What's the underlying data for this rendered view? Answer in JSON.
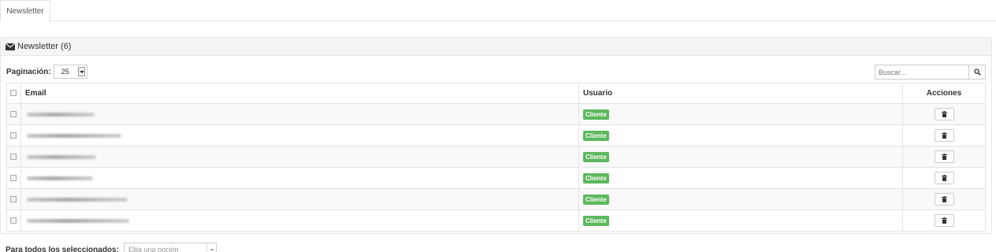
{
  "tabs": [
    {
      "label": "Newsletter"
    }
  ],
  "panel": {
    "title": "Newsletter (6)",
    "icon": "envelope-icon"
  },
  "pagination": {
    "label": "Paginación:",
    "value": "25"
  },
  "search": {
    "placeholder": "Buscar...",
    "icon": "search-icon"
  },
  "table": {
    "headers": {
      "email": "Email",
      "user": "Usuario",
      "actions": "Acciones"
    },
    "rows": [
      {
        "email_redacted": true,
        "user": "Cliente"
      },
      {
        "email_redacted": true,
        "user": "Cliente"
      },
      {
        "email_redacted": true,
        "user": "Cliente"
      },
      {
        "email_redacted": true,
        "user": "Cliente"
      },
      {
        "email_redacted": true,
        "user": "Cliente"
      },
      {
        "email_redacted": true,
        "user": "Cliente"
      }
    ]
  },
  "bulk": {
    "label": "Para todos los seleccionados:",
    "placeholder": "Elija una opción"
  },
  "colors": {
    "label_success": "#5cb85c",
    "panel_heading_bg": "#f5f5f5"
  }
}
